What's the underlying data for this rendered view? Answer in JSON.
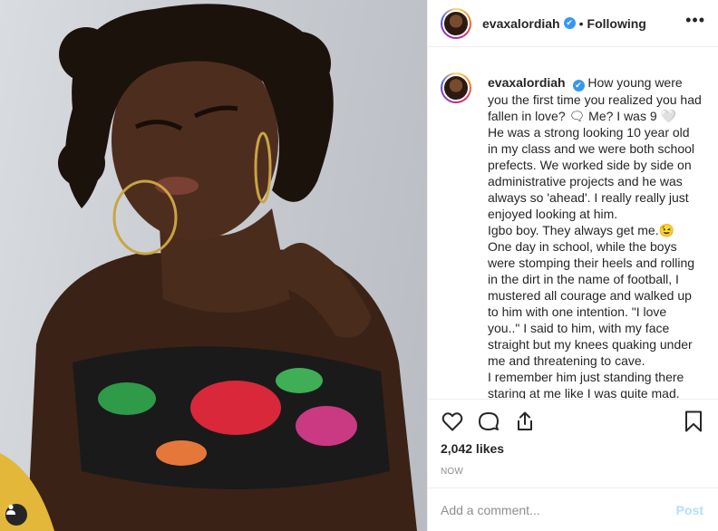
{
  "post": {
    "username": "evaxalordiah",
    "verified_mark": "✔",
    "separator": "•",
    "follow_status": "Following",
    "more_label": "•••",
    "caption_lines": [
      "How young were you the first time you realized you had fallen in love? 🗨 Me? I was 9 🤍",
      "He was a strong looking 10 year old in my class and we were both school prefects. We worked side by side on administrative projects and he was always so 'ahead'. I really really just enjoyed looking at him.",
      "Igbo boy. They always get me.😉 One day in school, while the boys were stomping their heels and rolling in the dirt in the name of football, I mustered all courage and walked up to him with one intention. \"I love you..\" I said to him, with my face straight but my knees quaking under me and threatening to cave.",
      "I remember him just standing there staring at me like I was quite mad."
    ],
    "likes": "2,042 likes",
    "timestamp": "NOW",
    "comment_placeholder": "Add a comment...",
    "post_button": "Post"
  },
  "icons": {
    "like": "heart-icon",
    "comment": "comment-icon",
    "share": "share-icon",
    "save": "bookmark-icon",
    "user_tag": "person-icon",
    "options": "more-options-icon"
  },
  "colors": {
    "verified": "#3897f0",
    "post_button": "#b2dffc",
    "muted": "#8e8e8e",
    "text": "#262626"
  }
}
